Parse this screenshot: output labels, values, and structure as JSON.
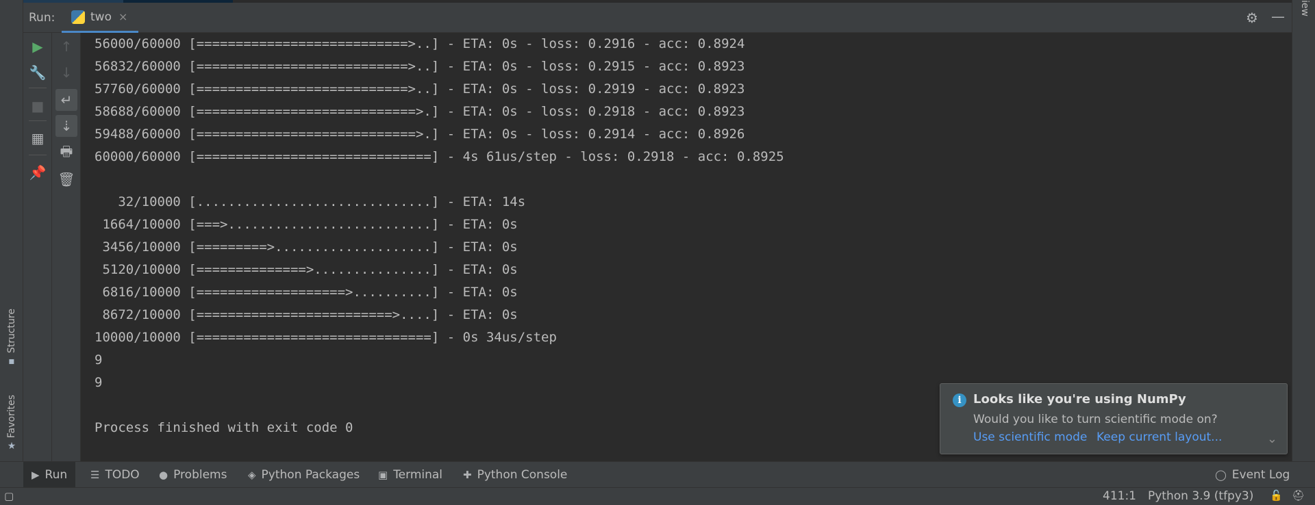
{
  "run_window": {
    "title": "Run:",
    "tab_label": "two",
    "tab_close": "×"
  },
  "header_icons": {
    "settings": "⚙",
    "minimize": "—"
  },
  "right_stripe": {
    "label": "iew"
  },
  "left_stripe": {
    "structure_label": "Structure",
    "favorites_label": "Favorites"
  },
  "toolbar1": {
    "run": "▶",
    "wrench": "🔧",
    "stop": "■",
    "layout": "▦",
    "pin": "📌"
  },
  "toolbar2": {
    "up": "↑",
    "down": "↓",
    "soft_wrap": "↵",
    "scroll_end": "⇣",
    "print": "🖶",
    "trash": "🗑"
  },
  "console": {
    "lines": [
      "56000/60000 [===========================>..] - ETA: 0s - loss: 0.2916 - acc: 0.8924",
      "56832/60000 [===========================>..] - ETA: 0s - loss: 0.2915 - acc: 0.8923",
      "57760/60000 [===========================>..] - ETA: 0s - loss: 0.2919 - acc: 0.8923",
      "58688/60000 [============================>.] - ETA: 0s - loss: 0.2918 - acc: 0.8923",
      "59488/60000 [============================>.] - ETA: 0s - loss: 0.2914 - acc: 0.8926",
      "60000/60000 [==============================] - 4s 61us/step - loss: 0.2918 - acc: 0.8925",
      "",
      "   32/10000 [..............................] - ETA: 14s",
      " 1664/10000 [===>..........................] - ETA: 0s",
      " 3456/10000 [=========>....................] - ETA: 0s",
      " 5120/10000 [==============>...............] - ETA: 0s",
      " 6816/10000 [===================>..........] - ETA: 0s",
      " 8672/10000 [=========================>....] - ETA: 0s",
      "10000/10000 [==============================] - 0s 34us/step",
      "9",
      "9",
      "",
      "Process finished with exit code 0"
    ]
  },
  "notification": {
    "icon": "i",
    "title": "Looks like you're using NumPy",
    "text": "Would you like to turn scientific mode on?",
    "link_primary": "Use scientific mode",
    "link_secondary": "Keep current layout...",
    "chevron": "⌄"
  },
  "bottom_tabs": [
    {
      "icon": "▶",
      "label": "Run"
    },
    {
      "icon": "☰",
      "label": "TODO"
    },
    {
      "icon": "●",
      "label": "Problems"
    },
    {
      "icon": "◈",
      "label": "Python Packages"
    },
    {
      "icon": "▣",
      "label": "Terminal"
    },
    {
      "icon": "✚",
      "label": "Python Console"
    }
  ],
  "event_log": {
    "icon": "◯",
    "label": "Event Log"
  },
  "status_bar": {
    "position": "411:1",
    "interpreter": "Python 3.9 (tfpy3)",
    "lock_icon": "🔓",
    "inspector_icon": "⛑"
  },
  "colors": {
    "background": "#2b2b2b",
    "panel": "#3c3f41",
    "text": "#bbbbbb",
    "run_green": "#59a869",
    "link_blue": "#589df6",
    "info_blue": "#3592c4",
    "tab_underline": "#4a88c7"
  }
}
